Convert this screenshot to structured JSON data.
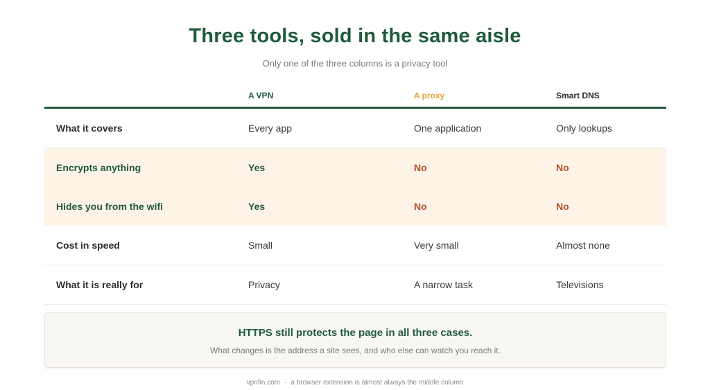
{
  "title": "Three tools, sold in the same aisle",
  "subtitle": "Only one of the three columns is a privacy tool",
  "colors": {
    "accent_green": "#1e5a3c",
    "accent_orange": "#e8a23a",
    "no_red": "#b2502a",
    "highlight_band": "#fdf3e7"
  },
  "table": {
    "columns": [
      "A VPN",
      "A proxy",
      "Smart DNS"
    ],
    "rows": [
      {
        "label": "What it covers",
        "values": [
          "Every app",
          "One application",
          "Only lookups"
        ]
      },
      {
        "label": "Encrypts anything",
        "values": [
          "Yes",
          "No",
          "No"
        ]
      },
      {
        "label": "Hides you from the wifi",
        "values": [
          "Yes",
          "No",
          "No"
        ]
      },
      {
        "label": "Cost in speed",
        "values": [
          "Small",
          "Very small",
          "Almost none"
        ]
      },
      {
        "label": "What it is really for",
        "values": [
          "Privacy",
          "A narrow task",
          "Televisions"
        ]
      }
    ]
  },
  "note": {
    "title": "HTTPS still protects the page in all three cases.",
    "body": "What changes is the address a site sees, and who else can watch you reach it."
  },
  "footer": {
    "site": "vpnfin.com",
    "separator": "·",
    "text": "a browser extension is almost always the middle column"
  }
}
